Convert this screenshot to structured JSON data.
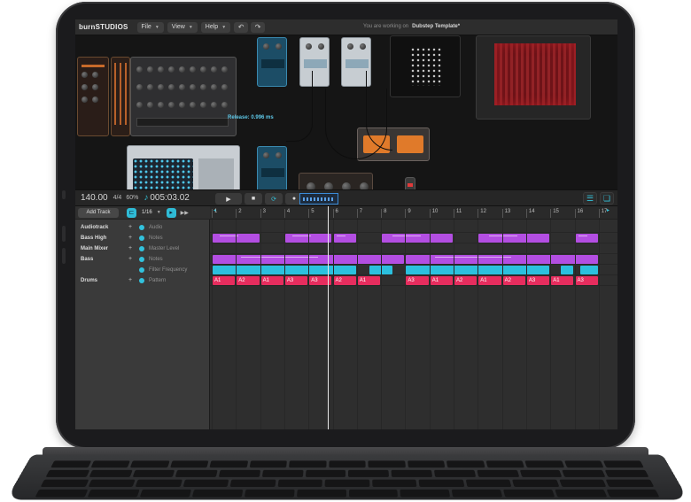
{
  "app": {
    "logo": "burnSTUDIOS",
    "menus": [
      {
        "label": "File"
      },
      {
        "label": "View"
      },
      {
        "label": "Help"
      }
    ],
    "working_prefix": "You are working on",
    "project_name": "Dubstep Template*"
  },
  "rack": {
    "release_readout": "Release: 0.996 ms"
  },
  "transport": {
    "tempo": "140.00",
    "meter": "4/4",
    "swing": "60%",
    "time": "005:03.02"
  },
  "tracks_header": {
    "add_track_label": "Add Track",
    "quantize": "1/16"
  },
  "tracks": [
    {
      "name": "Audiotrack",
      "sub": "Audio"
    },
    {
      "name": "Bass High",
      "sub": "Notes"
    },
    {
      "name": "Main Mixer",
      "sub": "Master Level"
    },
    {
      "name": "Bass",
      "sub": "Notes"
    },
    {
      "name": "",
      "sub": "Filter Frequency"
    },
    {
      "name": "Drums",
      "sub": "Pattern"
    }
  ],
  "ruler": [
    "1",
    "2",
    "3",
    "4",
    "5",
    "6",
    "7",
    "8",
    "9",
    "10",
    "11",
    "12",
    "13",
    "14",
    "15",
    "16",
    "17"
  ],
  "drum_clips": [
    "A1",
    "A2",
    "A1",
    "A3",
    "A3",
    "A2",
    "A1",
    "A3",
    "A1",
    "A2",
    "A1",
    "A2",
    "A3",
    "A1",
    "A3"
  ],
  "colors": {
    "accent": "#2fbbd6",
    "notes_clip": "#b34ee2",
    "automation_clip": "#2bc0de",
    "pattern_clip": "#e62d5e"
  }
}
